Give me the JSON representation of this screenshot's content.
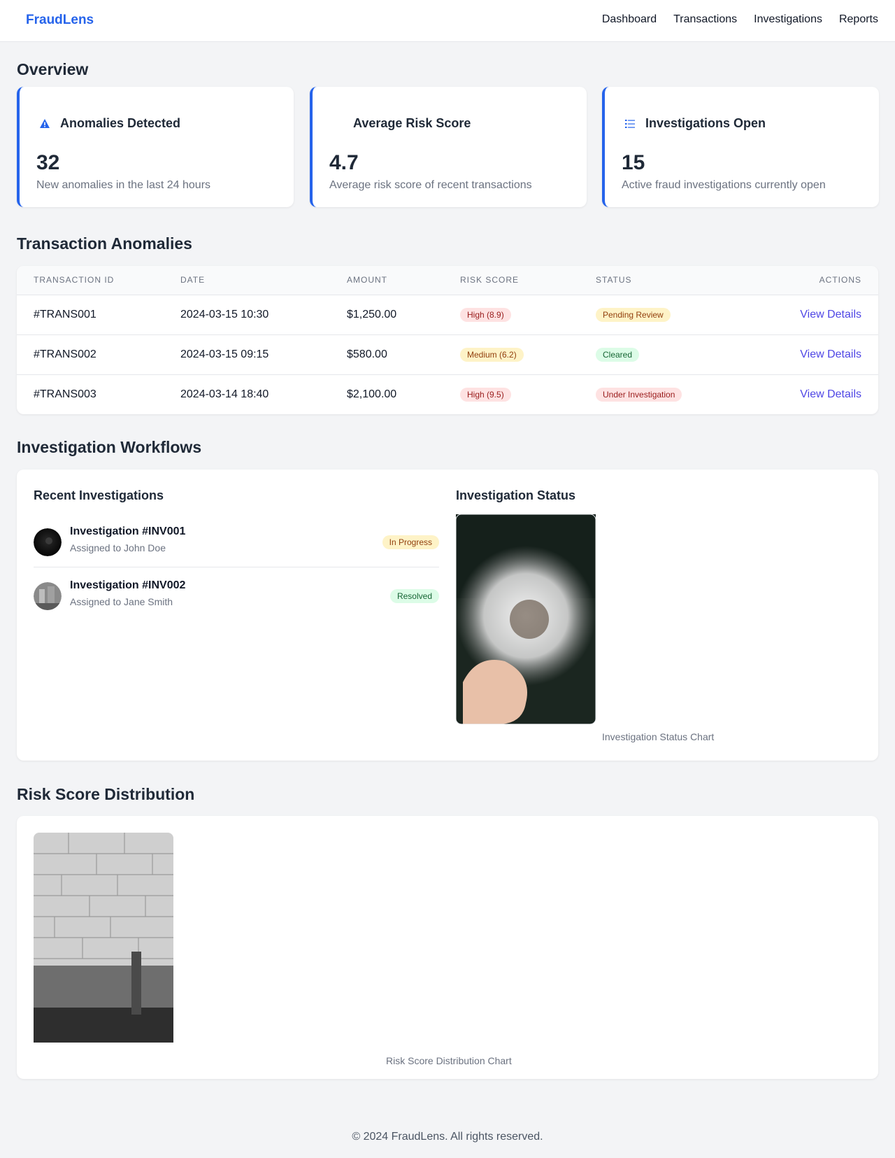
{
  "nav": {
    "brand": "FraudLens",
    "links": [
      "Dashboard",
      "Transactions",
      "Investigations",
      "Reports"
    ]
  },
  "overview": {
    "title": "Overview",
    "cards": [
      {
        "title": "Anomalies Detected",
        "value": "32",
        "desc": "New anomalies in the last 24 hours",
        "icon": "warning-icon"
      },
      {
        "title": "Average Risk Score",
        "value": "4.7",
        "desc": "Average risk score of recent transactions",
        "icon": "none"
      },
      {
        "title": "Investigations Open",
        "value": "15",
        "desc": "Active fraud investigations currently open",
        "icon": "checklist-icon"
      }
    ]
  },
  "anomalies": {
    "title": "Transaction Anomalies",
    "headers": [
      "TRANSACTION ID",
      "DATE",
      "AMOUNT",
      "RISK SCORE",
      "STATUS",
      "ACTIONS"
    ],
    "rows": [
      {
        "id": "#TRANS001",
        "date": "2024-03-15 10:30",
        "amount": "$1,250.00",
        "risk": "High (8.9)",
        "status": "Pending Review",
        "action": "View Details"
      },
      {
        "id": "#TRANS002",
        "date": "2024-03-15 09:15",
        "amount": "$580.00",
        "risk": "Medium (6.2)",
        "status": "Cleared",
        "action": "View Details"
      },
      {
        "id": "#TRANS003",
        "date": "2024-03-14 18:40",
        "amount": "$2,100.00",
        "risk": "High (9.5)",
        "status": "Under Investigation",
        "action": "View Details"
      }
    ]
  },
  "workflows": {
    "title": "Investigation Workflows",
    "recent_title": "Recent Investigations",
    "investigations": [
      {
        "title": "Investigation #INV001",
        "assignee": "Assigned to John Doe",
        "status": "In Progress"
      },
      {
        "title": "Investigation #INV002",
        "assignee": "Assigned to Jane Smith",
        "status": "Resolved"
      }
    ],
    "status_title": "Investigation Status",
    "status_caption": "Investigation Status Chart"
  },
  "risk": {
    "title": "Risk Score Distribution",
    "caption": "Risk Score Distribution Chart"
  },
  "footer": "© 2024 FraudLens. All rights reserved.",
  "colors": {
    "accent": "#2563eb",
    "link": "#4f46e5",
    "background": "#f3f4f6"
  }
}
